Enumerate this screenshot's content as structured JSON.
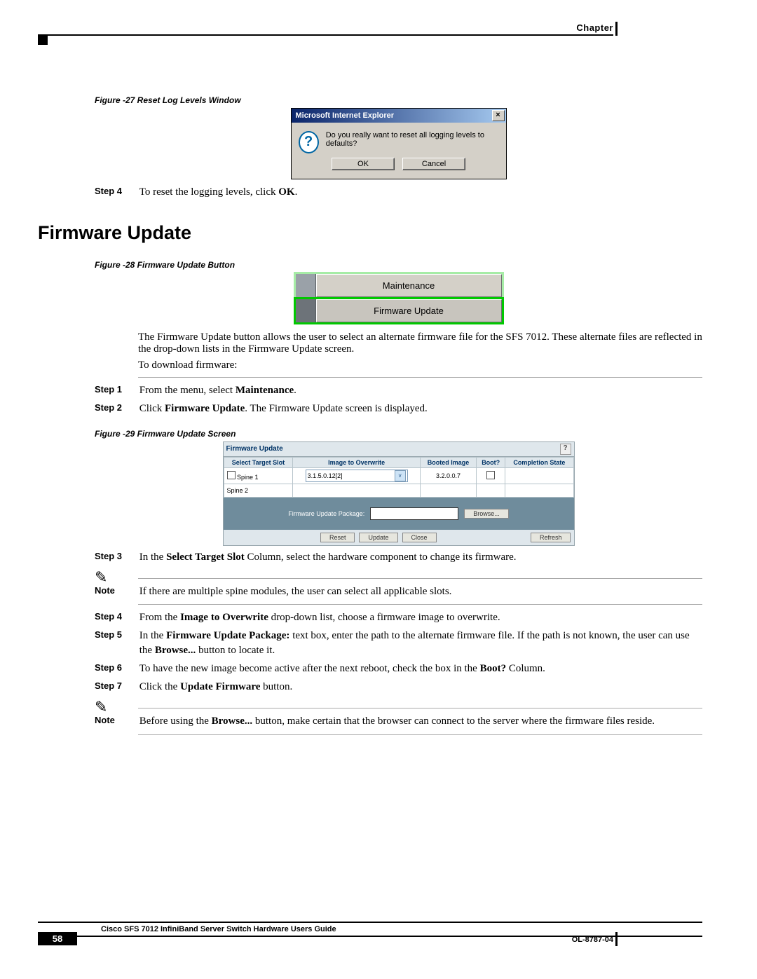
{
  "header": {
    "chapter": "Chapter"
  },
  "figures": {
    "f27": {
      "caption": "Figure -27   Reset Log Levels Window"
    },
    "f28": {
      "caption": "Figure -28   Firmware Update Button"
    },
    "f29": {
      "caption": "Figure -29   Firmware Update Screen"
    }
  },
  "dialog_reset": {
    "title": "Microsoft Internet Explorer",
    "message": "Do you really want to reset all logging levels to defaults?",
    "ok": "OK",
    "cancel": "Cancel",
    "close_x": "×"
  },
  "step4a_label": "Step 4",
  "step4a_text_before": "To reset the logging levels, click ",
  "step4a_bold": "OK",
  "step4a_text_after": ".",
  "section_title": "Firmware Update",
  "fub": {
    "maintenance": "Maintenance",
    "firmware": "Firmware Update"
  },
  "fub_paragraph": "The Firmware Update button allows the user to select an alternate firmware file for the SFS 7012. These alternate files are reflected in the drop-down lists in the Firmware Update screen.",
  "to_download": "To download firmware:",
  "step1_label": "Step 1",
  "step1_before": "From the menu, select ",
  "step1_bold": "Maintenance",
  "step1_after": ".",
  "step2_label": "Step 2",
  "step2_before": "Click ",
  "step2_bold": "Firmware Update",
  "step2_after": ". The Firmware Update screen is displayed.",
  "fus": {
    "title": "Firmware Update",
    "help": "?",
    "cols": {
      "target": "Select Target Slot",
      "image_overwrite": "Image to Overwrite",
      "booted": "Booted Image",
      "bootq": "Boot?",
      "completion": "Completion State"
    },
    "rows": [
      {
        "slot": "Spine 1",
        "overwrite": "3.1.5.0.12[2]",
        "booted": "3.2.0.0.7"
      },
      {
        "slot": "Spine 2",
        "overwrite": "",
        "booted": ""
      }
    ],
    "pkg_label": "Firmware Update Package:",
    "browse": "Browse...",
    "btn_reset": "Reset",
    "btn_update": "Update",
    "btn_close": "Close",
    "btn_refresh": "Refresh",
    "chev": "v"
  },
  "step3_label": "Step 3",
  "step3_before": "In the ",
  "step3_bold": "Select Target Slot",
  "step3_after": " Column, select the hardware component to change its firmware.",
  "note1_label": "Note",
  "note1_text": "If there are multiple spine modules, the user can select all applicable slots.",
  "step4_label": "Step 4",
  "step4_before": "From the ",
  "step4_bold": "Image to Overwrite",
  "step4_after": " drop-down list, choose a firmware image to overwrite.",
  "step5_label": "Step 5",
  "step5_before": "In the ",
  "step5_bold1": "Firmware Update Package:",
  "step5_mid": " text box, enter the path to the alternate firmware file. If the path is not known, the user can use the ",
  "step5_bold2": "Browse...",
  "step5_after": " button to locate it.",
  "step6_label": "Step 6",
  "step6_before": "To have the new image become active after the next reboot, check the box in the ",
  "step6_bold": "Boot?",
  "step6_after": " Column.",
  "step7_label": "Step 7",
  "step7_before": "Click the ",
  "step7_bold": "Update Firmware",
  "step7_after": " button.",
  "note2_label": "Note",
  "note2_before": "Before using the ",
  "note2_bold": "Browse...",
  "note2_after": " button, make certain that the browser can connect to the server where the firmware files reside.",
  "footer": {
    "guide": "Cisco SFS 7012 InfiniBand Server Switch Hardware Users Guide",
    "page": "58",
    "docid": "OL-8787-04"
  }
}
